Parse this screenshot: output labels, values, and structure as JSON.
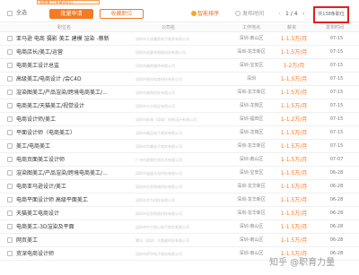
{
  "topbar": {
    "filter_tag": "电商美工(关键词)(5)"
  },
  "toolbar": {
    "select_all_label": "全选",
    "apply_label": "批量申请",
    "favorite_label": "收藏职位",
    "smart_sort_label": "智能排序",
    "time_sort_label": "发布时间",
    "prev_page": "‹",
    "page_indicator": "1 / 4",
    "next_page": "›",
    "total_count": "共138条职位"
  },
  "table": {
    "headers": {
      "position": "职位名",
      "company": "公司名",
      "location": "工作地点",
      "salary": "薪资",
      "date": "发布时间"
    },
    "rows": [
      {
        "title": "亚马逊 电商 摄影 美工 建模 渲染 -蔡新",
        "company": "深圳市大成耀荣电子商务有限公司",
        "location": "深圳-南山区",
        "salary": "1-1.5万/月",
        "date": "07-15"
      },
      {
        "title": "电商店长/美工/运营",
        "company": "深圳市创意库网络科技有限公司",
        "location": "深圳-龙华新区",
        "salary": "1-1.5万/月",
        "date": "07-15"
      },
      {
        "title": "电商美工设计总监",
        "company": "深圳市美颜服饰有限公司",
        "location": "深圳-宝安区",
        "salary": "1-2万/月",
        "date": "07-15"
      },
      {
        "title": "高级美工/电商设计 /会C4D",
        "company": "深圳市视觉电商科技有限公司",
        "location": "深圳",
        "salary": "1-1.5万/月",
        "date": "07-15"
      },
      {
        "title": "渲染图美工/产品渲染/跨境电商美工/...",
        "company": "深圳市骏和科技有限公司",
        "location": "深圳-龙华新区",
        "salary": "1-1.5万/月",
        "date": "07-15"
      },
      {
        "title": "电商美工/天猫美工/视觉设计",
        "company": "深圳市卡方纸业有限公司",
        "location": "深圳-龙岗区",
        "salary": "1-1.5万/月",
        "date": "07-15"
      },
      {
        "title": "电商设计师/美工",
        "company": "深圳市前海（深圳）创新设计有限公司",
        "location": "深圳-福田区",
        "salary": "1-1.2万/月",
        "date": "07-15"
      },
      {
        "title": "平面设计师（电商美工）",
        "company": "深圳市精品电子商务有限公司",
        "location": "深圳-龙岗区",
        "salary": "1-1.5万/月",
        "date": "07-15"
      },
      {
        "title": "美工/电商美工",
        "company": "深圳市华美电子商务有限公司",
        "location": "深圳-龙华新区",
        "salary": "1-1.5万/月",
        "date": "07-15"
      },
      {
        "title": "电商页面美工设计师",
        "company": "广州市星辉信息技术有限公司",
        "location": "深圳-南山区",
        "salary": "1-1.5万/月",
        "date": "07-07"
      },
      {
        "title": "渲染图美工/产品渲染/跨境电商美工/...",
        "company": "深圳市晶盛光电科技有限公司",
        "location": "深圳-宝安区",
        "salary": "1-1.5万/月",
        "date": "06-28"
      },
      {
        "title": "电商亚马逊设计/美工",
        "company": "深圳市佳思网络科技有限公司",
        "location": "深圳-龙华新区",
        "salary": "1-1.5万/月",
        "date": "06-28"
      },
      {
        "title": "电商平面设计师 高级平面美工",
        "company": "深圳市华为科技有限公司",
        "location": "深圳-龙华新区",
        "salary": "1-1.5万/月",
        "date": "06-28"
      },
      {
        "title": "天猫美工电商设计",
        "company": "深圳市佳思网络科技有限公司",
        "location": "深圳-龙华新区",
        "salary": "1-1.5万/月",
        "date": "06-28"
      },
      {
        "title": "电商美工-3D渲染及平面",
        "company": "深圳市中大南山电子商务有限公司",
        "location": "深圳-南山区",
        "salary": "1-1.5万/月",
        "date": "06-28"
      },
      {
        "title": "网页美工",
        "company": "腾讯（深圳）大数据科技有限公司",
        "location": "深圳-南山区",
        "salary": "1-1.5万/月",
        "date": "06-28"
      },
      {
        "title": "资深电商设计师",
        "company": "深圳市伊华电子商务有限公司",
        "location": "深圳-南山区",
        "salary": "1-1.5万/月",
        "date": "06-28"
      }
    ]
  },
  "watermark": "知乎 @职育力量"
}
